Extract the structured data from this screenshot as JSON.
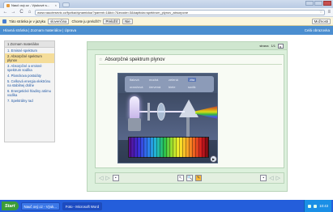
{
  "browser": {
    "tab_title": "Nauč ový.cz - Výukové s...",
    "close_glyph": "×",
    "url": "www.nauctesevic.cz/fyzika/dynamicka/?parent=1&tid=7&ecode=3&kapitola=spektrum_plynov_absorpcne",
    "back_glyph": "←",
    "forward_glyph": "→",
    "reload_glyph": "C",
    "home_glyph": "⌂",
    "star_glyph": "☆",
    "menu_glyph": "≡"
  },
  "translate_bar": {
    "message": "Táto stránka je v jazyku",
    "language": "slovenčina",
    "question": "Chcete ju preložiť?",
    "translate_button": "Preložiť",
    "no_button": "Nie",
    "options": "Možnosti"
  },
  "site_nav": {
    "left": "Hlavná stránka  |  Zoznam materiálov  |  Úprava",
    "right": "Celá obrazovka"
  },
  "sidebar": {
    "header": "1 Zoznam materiálov",
    "items": [
      {
        "label": "1. Emisné spektrum",
        "active": false
      },
      {
        "label": "2. Absorpčné spektrum plynov",
        "active": true
      },
      {
        "label": "3. Absorpčné a emisné spektrum sodíka",
        "active": false
      },
      {
        "label": "4. Planckova postuláty",
        "active": false
      },
      {
        "label": "5. Celková energia elektrónu na stabilnej dráhe",
        "active": false
      },
      {
        "label": "6. Energetické hladiny atómu vodíka",
        "active": false
      },
      {
        "label": "7. Spektrálny rad",
        "active": false
      }
    ]
  },
  "content": {
    "page_label": "strana",
    "page_value": "1/1",
    "next_glyph": "▸",
    "title": "Absorpčné spektrum plynov",
    "section_glyph": "☆",
    "filters": [
      "fialová",
      "modrá",
      "zelená",
      "žltá",
      "oranžová",
      "červená",
      "biele",
      "sodík"
    ],
    "selected_filter": "žltá",
    "play_glyph": "▶"
  },
  "controls": {
    "prev_glyph": "◁",
    "next_glyph": "▷",
    "left_button": "▪",
    "cursor_button": "↖",
    "zoom_button": "🔍",
    "pen_button": "✎",
    "right_button": "▪"
  },
  "taskbar": {
    "start": "Start",
    "tasks": [
      {
        "label": "Nauč ový.cz - Výuk...",
        "active": false
      },
      {
        "label": "Foto - Microsoft Word",
        "active": true
      }
    ],
    "tray_time": "10:43"
  }
}
